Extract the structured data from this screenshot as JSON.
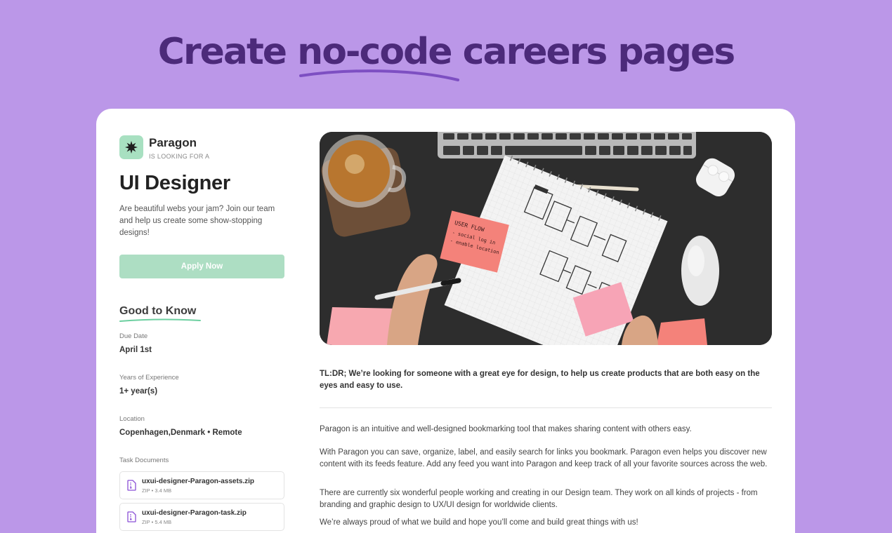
{
  "hero": {
    "title": "Create no-code careers pages"
  },
  "company": {
    "name": "Paragon",
    "tagline": "IS LOOKING FOR A"
  },
  "job": {
    "title": "UI Designer",
    "description": "Are beautiful webs your jam? Join our team and help us create some show-stopping designs!",
    "apply_label": "Apply Now"
  },
  "good_to_know": {
    "title": "Good to Know",
    "fields": [
      {
        "label": "Due Date",
        "value": "April 1st"
      },
      {
        "label": "Years of Experience",
        "value": "1+ year(s)"
      },
      {
        "label": "Location",
        "value": "Copenhagen,Denmark • Remote"
      }
    ],
    "documents_label": "Task Documents",
    "documents": [
      {
        "name": "uxui-designer-Paragon-assets.zip",
        "meta": "ZIP • 3.4 MB",
        "icon": "zip-file-icon"
      },
      {
        "name": "uxui-designer-Paragon-task.zip",
        "meta": "ZIP • 5.4 MB",
        "icon": "zip-file-icon"
      }
    ]
  },
  "content": {
    "tldr": "TL:DR; We’re looking for someone with a great eye for design, to help us create products that are both easy on the eyes and easy to use.",
    "paragraphs": [
      "Paragon is an intuitive and well-designed bookmarking tool that makes sharing content with others easy.",
      "With Paragon you can save, organize, label, and easily search for links you bookmark. Paragon even helps you discover new content with its feeds feature. Add any feed you want into Paragon and keep track of all your favorite sources across the web.",
      "There are currently six wonderful people working and creating in our Design team. They work on all kinds of projects - from branding and graphic design to UX/UI design for worldwide clients.",
      "We’re always proud of what we build and hope you’ll come and build great things with us!"
    ],
    "sticky_note": {
      "line1": "USER FLOW",
      "line2": "- social log in",
      "line3": "- enable location"
    }
  },
  "colors": {
    "background": "#bb97e8",
    "hero_text": "#4c2a7a",
    "accent_green": "#addec3",
    "logo_bg": "#a8e0c1",
    "sticky_pink": "#f4827a"
  }
}
